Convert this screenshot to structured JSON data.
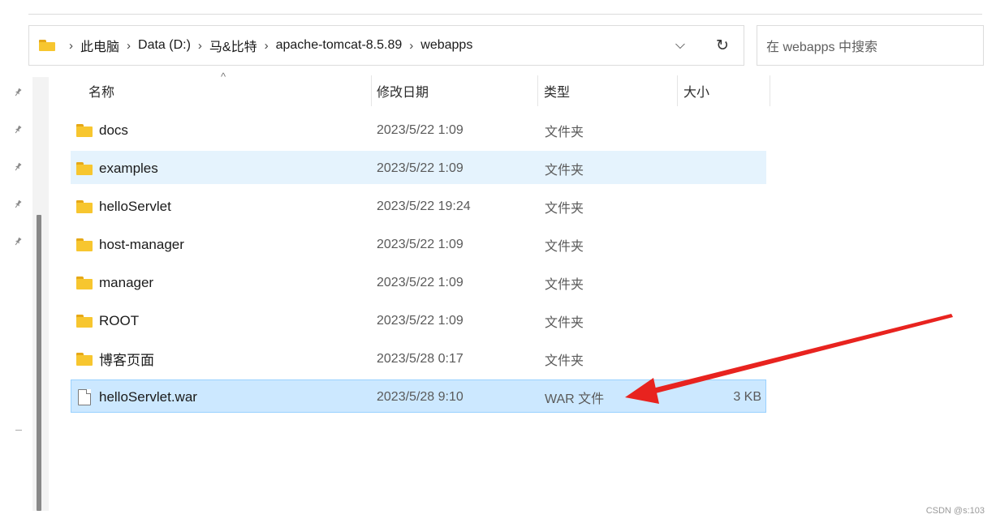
{
  "address": {
    "crumbs": [
      "此电脑",
      "Data (D:)",
      "马&比特",
      "apache-tomcat-8.5.89",
      "webapps"
    ],
    "separator": "›",
    "dropdown_glyph": "⌵",
    "refresh_glyph": "↻"
  },
  "search": {
    "placeholder": "在 webapps 中搜索"
  },
  "columns": {
    "name": "名称",
    "modified": "修改日期",
    "type": "类型",
    "size": "大小",
    "sort_glyph": "^"
  },
  "files": [
    {
      "name": "docs",
      "modified": "2023/5/22 1:09",
      "type": "文件夹",
      "size": "",
      "icon": "folder-icon"
    },
    {
      "name": "examples",
      "modified": "2023/5/22 1:09",
      "type": "文件夹",
      "size": "",
      "icon": "folder-icon"
    },
    {
      "name": "helloServlet",
      "modified": "2023/5/22 19:24",
      "type": "文件夹",
      "size": "",
      "icon": "folder-icon"
    },
    {
      "name": "host-manager",
      "modified": "2023/5/22 1:09",
      "type": "文件夹",
      "size": "",
      "icon": "folder-icon"
    },
    {
      "name": "manager",
      "modified": "2023/5/22 1:09",
      "type": "文件夹",
      "size": "",
      "icon": "folder-icon"
    },
    {
      "name": "ROOT",
      "modified": "2023/5/22 1:09",
      "type": "文件夹",
      "size": "",
      "icon": "folder-icon"
    },
    {
      "name": "博客页面",
      "modified": "2023/5/28 0:17",
      "type": "文件夹",
      "size": "",
      "icon": "folder-icon"
    },
    {
      "name": "helloServlet.war",
      "modified": "2023/5/28 9:10",
      "type": "WAR 文件",
      "size": "3 KB",
      "icon": "file-icon"
    }
  ],
  "nav": {
    "pin_glyph": "📌"
  },
  "watermark": "CSDN @s:103",
  "colors": {
    "arrow": "#e8231f",
    "selection": "#cce8ff",
    "hover": "#e5f3fd",
    "folder": "#f7c62f"
  }
}
